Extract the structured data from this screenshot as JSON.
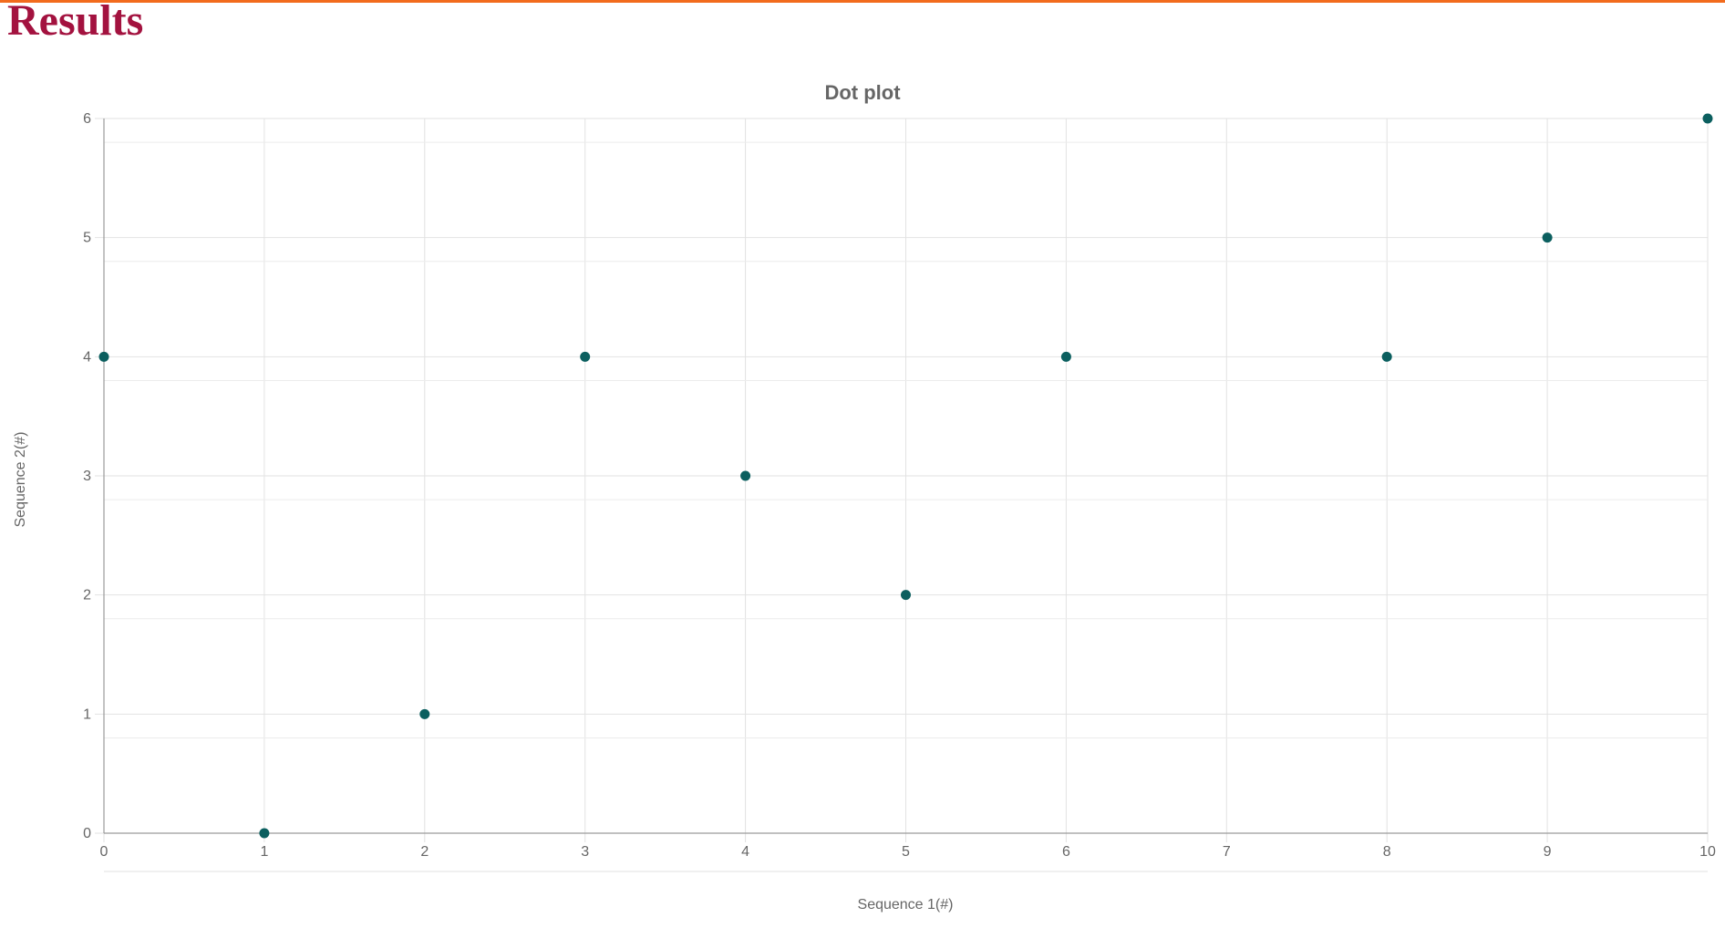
{
  "page": {
    "heading": "Results",
    "accent_color": "#f26b1d",
    "heading_color": "#a3123f"
  },
  "chart_data": {
    "type": "scatter",
    "title": "Dot plot",
    "xlabel": "Sequence 1(#)",
    "ylabel": "Sequence 2(#)",
    "xlim": [
      0,
      10
    ],
    "ylim": [
      0,
      6
    ],
    "x_ticks": [
      "0",
      "1",
      "2",
      "3",
      "4",
      "5",
      "6",
      "7",
      "8",
      "9",
      "10"
    ],
    "y_ticks": [
      "0",
      "1",
      "2",
      "3",
      "4",
      "5",
      "6"
    ],
    "grid": true,
    "point_color": "#0b5f5f",
    "points": [
      {
        "x": 0,
        "y": 4
      },
      {
        "x": 1,
        "y": 0
      },
      {
        "x": 2,
        "y": 1
      },
      {
        "x": 3,
        "y": 4
      },
      {
        "x": 4,
        "y": 3
      },
      {
        "x": 5,
        "y": 2
      },
      {
        "x": 6,
        "y": 4
      },
      {
        "x": 8,
        "y": 4
      },
      {
        "x": 9,
        "y": 5
      },
      {
        "x": 10,
        "y": 6
      }
    ]
  }
}
